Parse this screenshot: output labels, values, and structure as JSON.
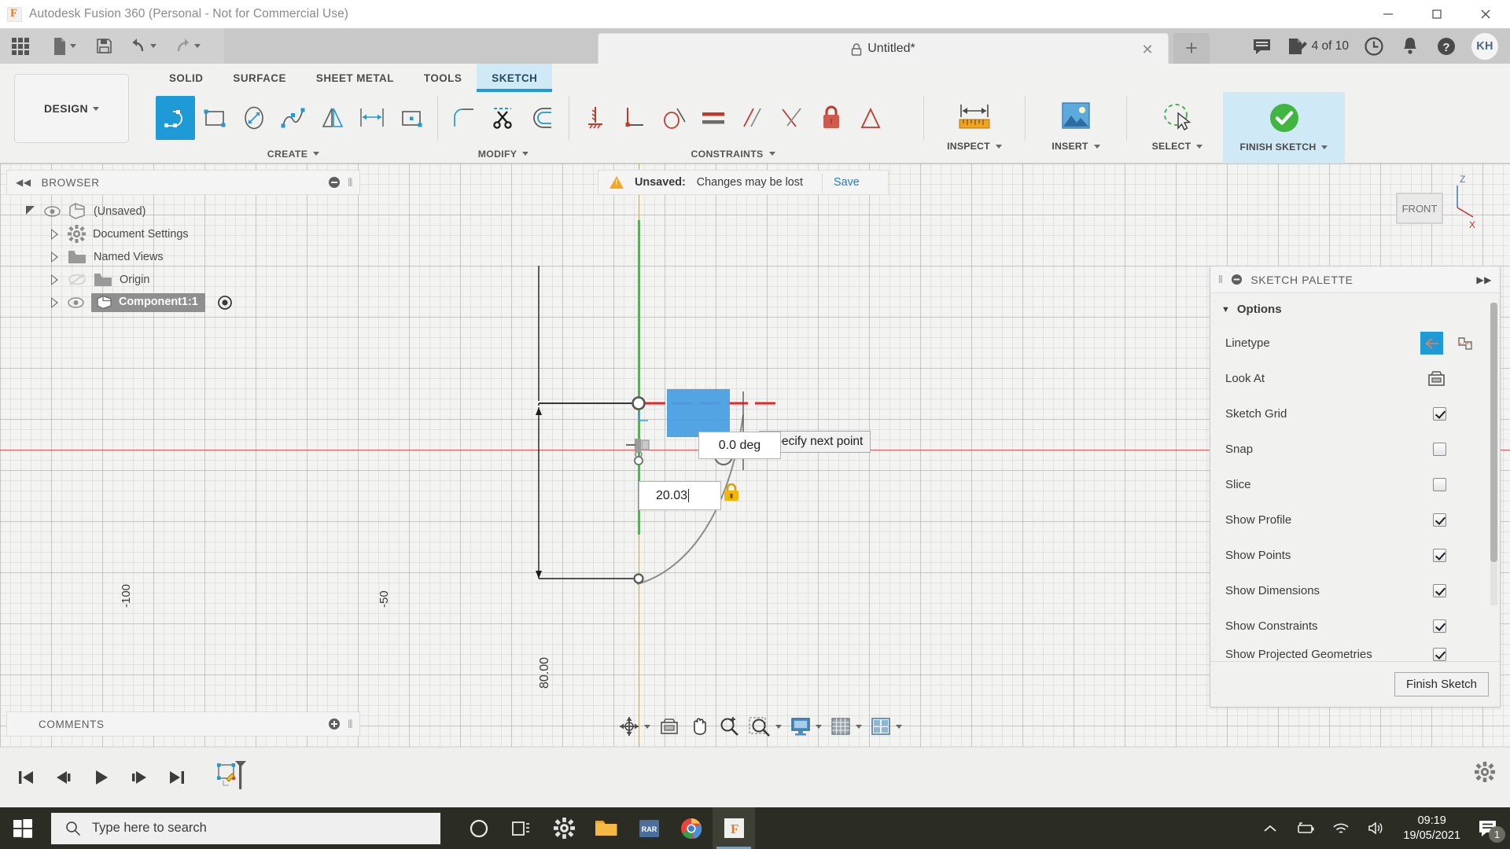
{
  "window": {
    "app_title": "Autodesk Fusion 360 (Personal - Not for Commercial Use)",
    "minimize": "—",
    "maximize": "▢",
    "close": "✕"
  },
  "quick_access": {
    "grid_tooltip": "Show Data Panel",
    "new_label": "New",
    "save_label": "Save",
    "undo_label": "Undo",
    "redo_label": "Redo"
  },
  "tab": {
    "title": "Untitled*",
    "close": "✕",
    "new_tab": "+"
  },
  "account_bar": {
    "job_status": "4 of 10",
    "avatar_initials": "KH"
  },
  "workspace": {
    "label": "DESIGN"
  },
  "ribbon": {
    "tabs": [
      {
        "label": "SOLID",
        "active": false
      },
      {
        "label": "SURFACE",
        "active": false
      },
      {
        "label": "SHEET METAL",
        "active": false
      },
      {
        "label": "TOOLS",
        "active": false
      },
      {
        "label": "SKETCH",
        "active": true
      }
    ],
    "panels": [
      {
        "name": "CREATE",
        "label": "CREATE"
      },
      {
        "name": "MODIFY",
        "label": "MODIFY"
      },
      {
        "name": "CONSTRAINTS",
        "label": "CONSTRAINTS"
      },
      {
        "name": "INSPECT",
        "label": "INSPECT"
      },
      {
        "name": "INSERT",
        "label": "INSERT"
      },
      {
        "name": "SELECT",
        "label": "SELECT"
      },
      {
        "name": "FINISH",
        "label": "FINISH SKETCH"
      }
    ],
    "create_tools": [
      "line",
      "rectangle",
      "circle",
      "spline",
      "mirror",
      "offset-distance",
      "point-rectangle",
      "arc"
    ],
    "modify_tools": [
      "trim",
      "offset"
    ],
    "constraint_tools": [
      "fix-ground",
      "perpendicular",
      "tangent",
      "equal",
      "parallel",
      "symmetry",
      "lock",
      "midpoint"
    ]
  },
  "browser": {
    "title": "BROWSER",
    "collapse": "◀◀",
    "items": [
      {
        "label": "(Unsaved)",
        "indent": 0,
        "selected": false
      },
      {
        "label": "Document Settings",
        "indent": 1,
        "selected": false
      },
      {
        "label": "Named Views",
        "indent": 1,
        "selected": false
      },
      {
        "label": "Origin",
        "indent": 1,
        "selected": false
      },
      {
        "label": "Component1:1",
        "indent": 1,
        "selected": true
      }
    ]
  },
  "notification": {
    "status": "Unsaved:",
    "message": "Changes may be lost",
    "action": "Save"
  },
  "canvas": {
    "tick_labels": [
      "-100",
      "-50"
    ],
    "dimension_label": "80.00",
    "angle_value": "0.0 deg",
    "length_input": "20.03",
    "tooltip": "Specify next point",
    "view_cube_face": "FRONT",
    "axis_z": "Z",
    "axis_x": "X"
  },
  "palette": {
    "title": "SKETCH PALETTE",
    "section": "Options",
    "options": [
      {
        "label": "Linetype",
        "type": "icons"
      },
      {
        "label": "Look At",
        "type": "icon"
      },
      {
        "label": "Sketch Grid",
        "type": "check",
        "checked": true
      },
      {
        "label": "Snap",
        "type": "check",
        "checked": false
      },
      {
        "label": "Slice",
        "type": "check",
        "checked": false
      },
      {
        "label": "Show Profile",
        "type": "check",
        "checked": true
      },
      {
        "label": "Show Points",
        "type": "check",
        "checked": true
      },
      {
        "label": "Show Dimensions",
        "type": "check",
        "checked": true
      },
      {
        "label": "Show Constraints",
        "type": "check",
        "checked": true
      },
      {
        "label": "Show Projected Geometries",
        "type": "check",
        "checked": true
      }
    ],
    "finish_button": "Finish Sketch"
  },
  "navbar": {
    "tools": [
      "orbit",
      "look-at",
      "pan",
      "zoom",
      "zoom-window",
      "display-settings",
      "grid-snaps",
      "viewports"
    ]
  },
  "timeline": {
    "buttons": [
      "go-to-beginning",
      "step-back",
      "play",
      "step-forward",
      "go-to-end"
    ],
    "feature": "sketch-feature",
    "settings": "timeline-settings"
  },
  "comments": {
    "title": "COMMENTS"
  },
  "taskbar": {
    "search_placeholder": "Type here to search",
    "apps": [
      "cortana",
      "task-view",
      "settings",
      "file-explorer",
      "winrar",
      "chrome",
      "fusion360"
    ],
    "time": "09:19",
    "date": "19/05/2021",
    "notification_count": "1"
  }
}
